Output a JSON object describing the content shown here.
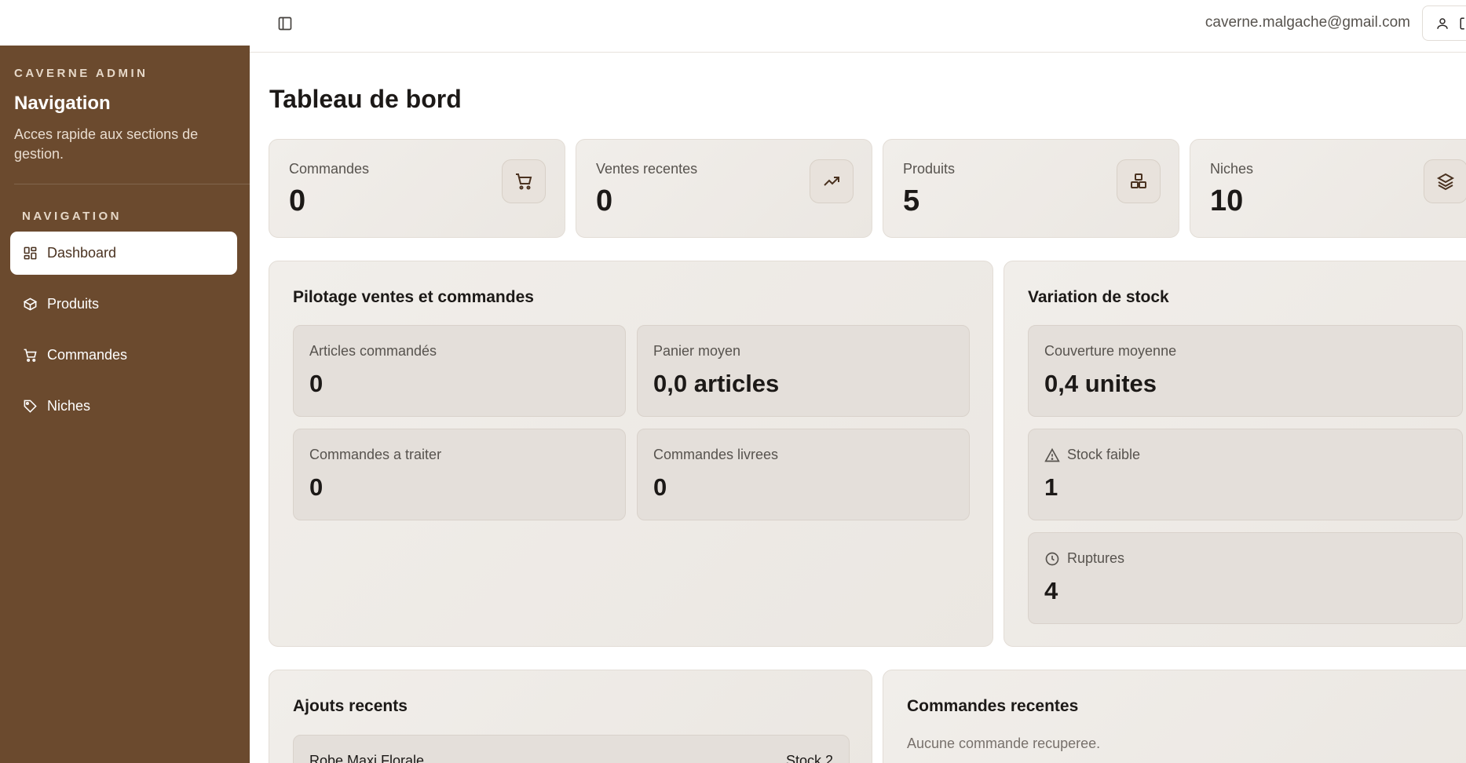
{
  "header": {
    "user_email": "caverne.malgache@gmail.com"
  },
  "sidebar": {
    "brand": "CAVERNE ADMIN",
    "title": "Navigation",
    "description": "Acces rapide aux sections de gestion.",
    "section_label": "NAVIGATION",
    "items": [
      {
        "label": "Dashboard",
        "icon": "dashboard-icon",
        "active": true
      },
      {
        "label": "Produits",
        "icon": "package-icon",
        "active": false
      },
      {
        "label": "Commandes",
        "icon": "cart-icon",
        "active": false
      },
      {
        "label": "Niches",
        "icon": "tag-icon",
        "active": false
      }
    ]
  },
  "main": {
    "title": "Tableau de bord",
    "stats": [
      {
        "label": "Commandes",
        "value": "0",
        "icon": "cart-icon"
      },
      {
        "label": "Ventes recentes",
        "value": "0",
        "icon": "trending-up-icon"
      },
      {
        "label": "Produits",
        "value": "5",
        "icon": "boxes-icon"
      },
      {
        "label": "Niches",
        "value": "10",
        "icon": "layers-icon"
      }
    ],
    "sales_panel": {
      "title": "Pilotage ventes et commandes",
      "metrics": [
        {
          "label": "Articles commandés",
          "value": "0"
        },
        {
          "label": "Panier moyen",
          "value": "0,0 articles"
        },
        {
          "label": "Commandes a traiter",
          "value": "0"
        },
        {
          "label": "Commandes livrees",
          "value": "0"
        }
      ]
    },
    "stock_panel": {
      "title": "Variation de stock",
      "metrics": [
        {
          "label": "Couverture moyenne",
          "value": "0,4 unites",
          "icon": ""
        },
        {
          "label": "Stock faible",
          "value": "1",
          "icon": "warning-icon"
        },
        {
          "label": "Ruptures",
          "value": "4",
          "icon": "clock-icon"
        }
      ]
    },
    "recent_additions": {
      "title": "Ajouts recents",
      "items": [
        {
          "name": "Robe Maxi Florale",
          "stock": "Stock 2"
        }
      ]
    },
    "recent_orders": {
      "title": "Commandes recentes",
      "empty_text": "Aucune commande recuperee."
    }
  },
  "colors": {
    "sidebar_bg": "#6b4a2e",
    "card_bg": "#efebe7",
    "accent_dark": "#4a3220"
  }
}
